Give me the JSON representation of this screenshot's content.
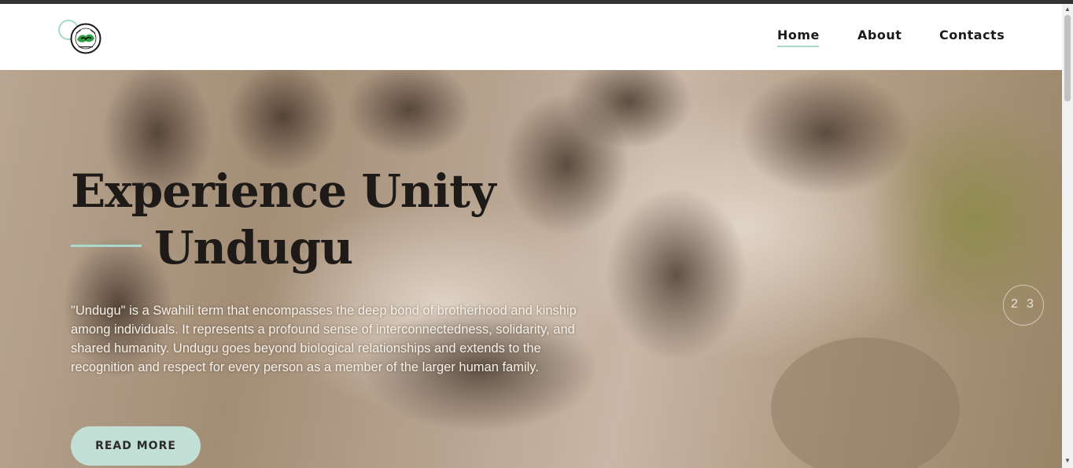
{
  "header": {
    "logo_alt": "Undugu logo",
    "nav": [
      {
        "label": "Home"
      },
      {
        "label": "About"
      },
      {
        "label": "Contacts"
      }
    ]
  },
  "hero": {
    "title_line_1": "Experience Unity",
    "title_line_2": "Undugu",
    "description": "\"Undugu\" is a Swahili term that encompasses the deep bond of brotherhood and kinship among individuals. It represents a profound sense of interconnectedness, solidarity, and shared humanity. Undugu goes beyond biological relationships and extends to the recognition and respect for every person as a member of the larger human family.",
    "cta_label": "READ MORE",
    "slides": [
      "2",
      "3"
    ]
  },
  "colors": {
    "accent": "#a9d8cc",
    "button_bg": "#c2dfd5",
    "title": "#1e1a17",
    "description": "#f6f1ea",
    "topbar": "#333333"
  },
  "icons": {
    "logo": "undugu-badge-icon",
    "scroll_up": "scroll-up-arrow-icon",
    "scroll_down": "scroll-down-arrow-icon"
  }
}
